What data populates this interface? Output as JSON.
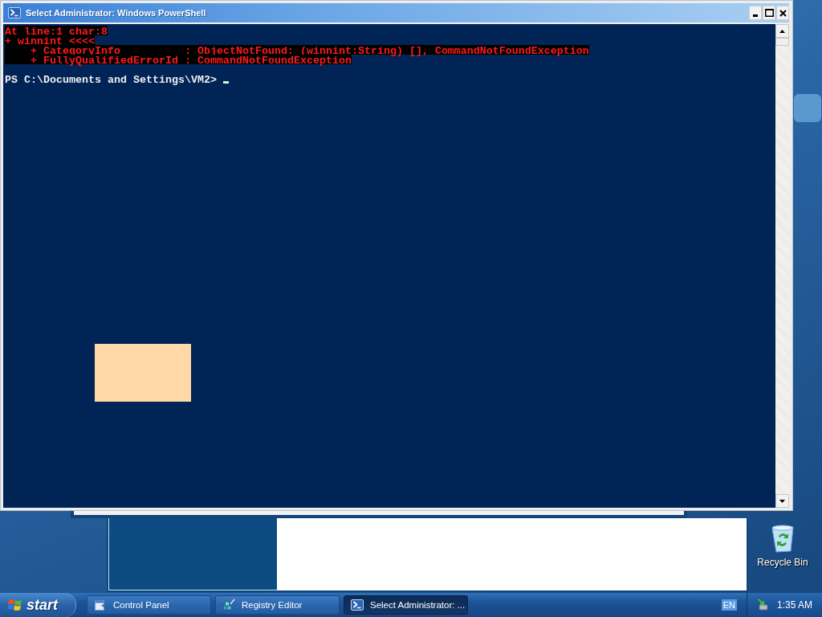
{
  "window": {
    "title": "Select Administrator: Windows PowerShell"
  },
  "console": {
    "lines": [
      {
        "kind": "error",
        "text": "At line:1 char:8"
      },
      {
        "kind": "error",
        "text": "+ winnint <<<<"
      },
      {
        "kind": "error",
        "text": "    + CategoryInfo          : ObjectNotFound: (winnint:String) [], CommandNotFoundException"
      },
      {
        "kind": "error",
        "text": "    + FullyQualifiedErrorId : CommandNotFoundException"
      },
      {
        "kind": "blank"
      },
      {
        "kind": "prompt",
        "text": "PS C:\\Documents and Settings\\VM2>",
        "cursor": true
      }
    ]
  },
  "desktop": {
    "icons": [
      {
        "label": "Recycle Bin"
      }
    ]
  },
  "taskbar": {
    "start": "start",
    "buttons": [
      {
        "kind": "control_panel",
        "label": "Control Panel",
        "selected": false
      },
      {
        "kind": "registry",
        "label": "Registry Editor",
        "selected": false
      },
      {
        "kind": "powershell",
        "label": "Select Administrator: ...",
        "selected": true
      }
    ],
    "tray": {
      "language": "EN",
      "clock": "1:35 AM"
    }
  }
}
